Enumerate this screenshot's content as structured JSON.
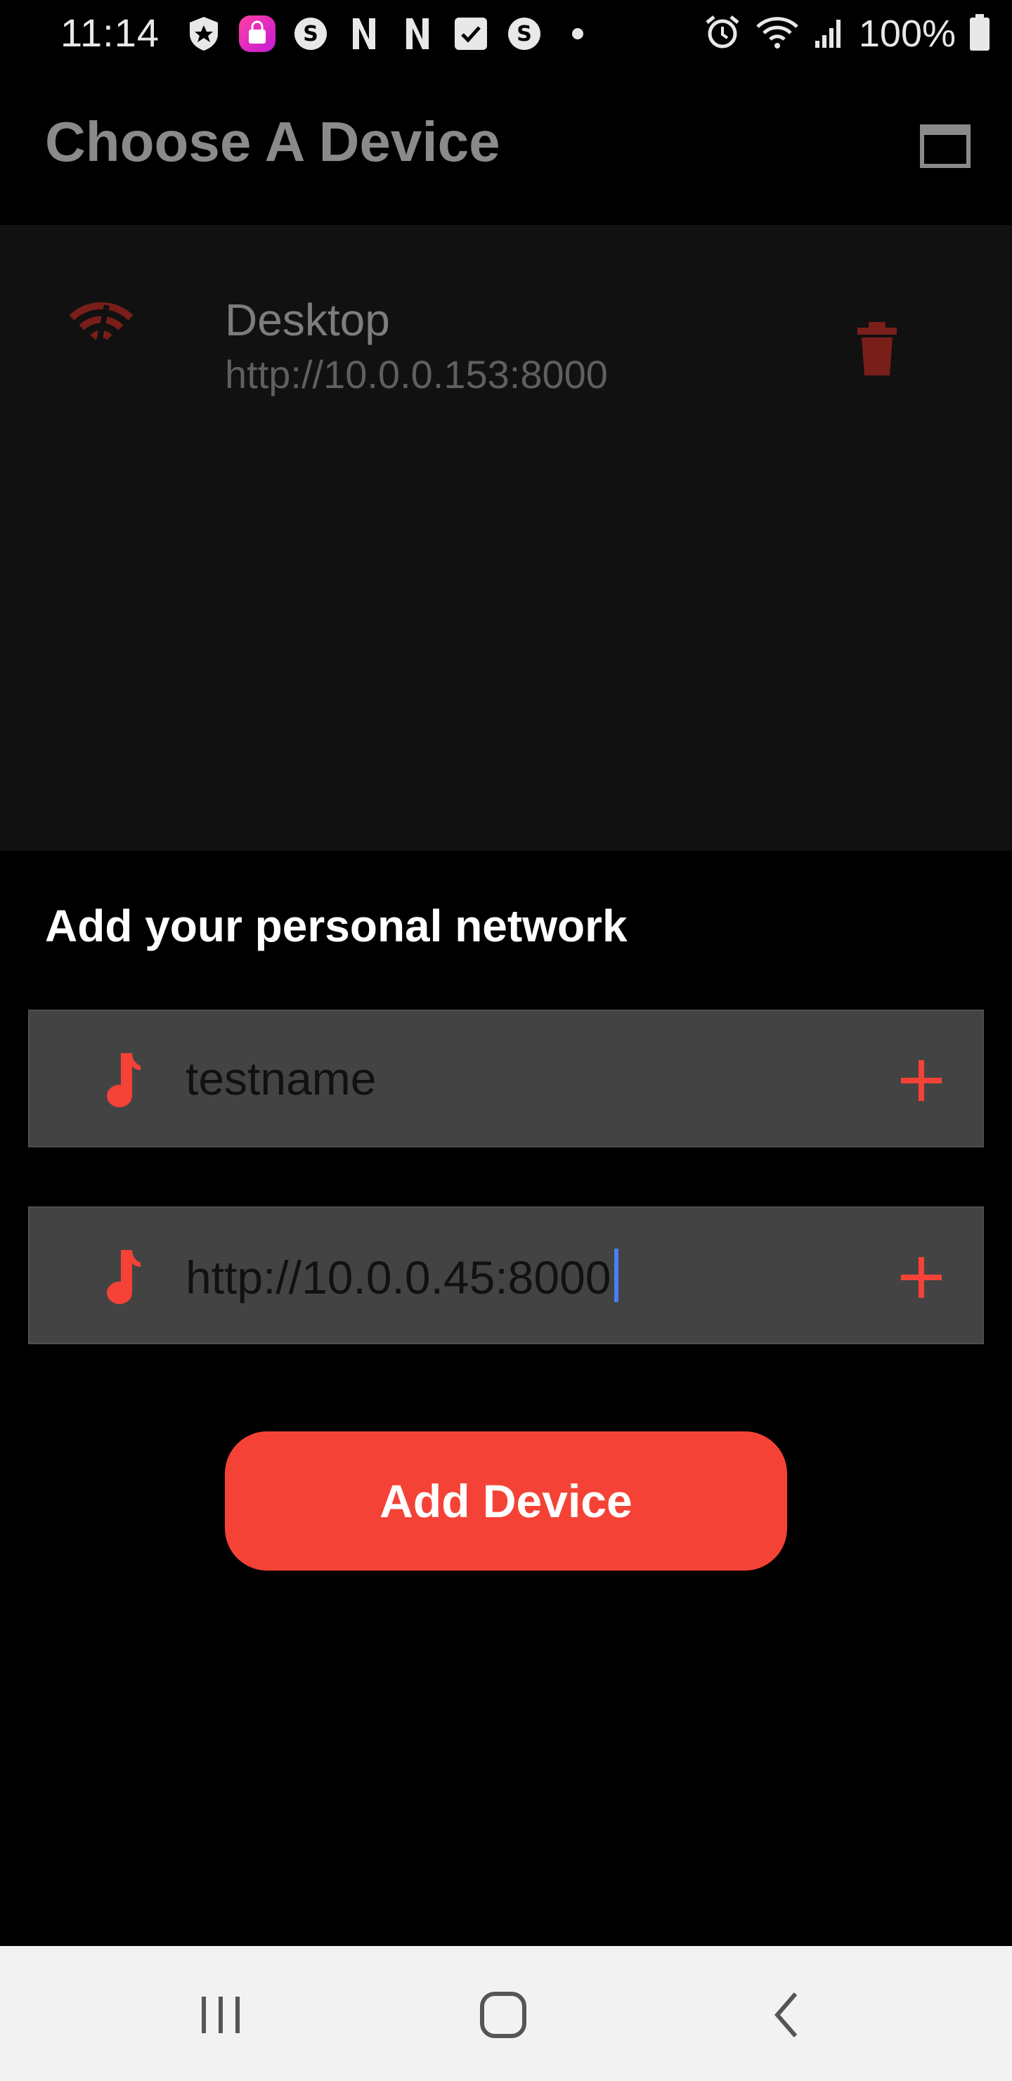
{
  "status_bar": {
    "time": "11:14",
    "battery_percent": "100%",
    "notification_icons": [
      "shield-icon",
      "shopping-bag-icon",
      "s-circle-icon",
      "netflix-n-icon",
      "netflix-n-icon",
      "checkbox-icon",
      "s-circle-icon",
      "dot-icon"
    ],
    "system_icons": [
      "alarm-icon",
      "wifi-icon",
      "signal-icon",
      "battery-icon"
    ]
  },
  "app_bar": {
    "title": "Choose A Device",
    "window_icon": "window-icon"
  },
  "devices": [
    {
      "name": "Desktop",
      "url": "http://10.0.0.153:8000",
      "icon": "wifi-icon",
      "delete_icon": "trash-icon"
    }
  ],
  "add_form": {
    "title": "Add your personal network",
    "name_field": {
      "value": "testname",
      "icon": "music-note-icon",
      "action_icon": "plus-icon"
    },
    "url_field": {
      "value": "http://10.0.0.45:8000",
      "icon": "music-note-icon",
      "action_icon": "plus-icon"
    },
    "submit_label": "Add Device"
  },
  "colors": {
    "accent": "#f44336",
    "accent_dim": "#7a1e1a",
    "input_bg": "#434343",
    "panel_bg": "#111111",
    "nav_bg": "#f2f2f2"
  },
  "nav_bar": {
    "buttons": [
      "recent-apps-icon",
      "home-icon",
      "back-icon"
    ]
  }
}
